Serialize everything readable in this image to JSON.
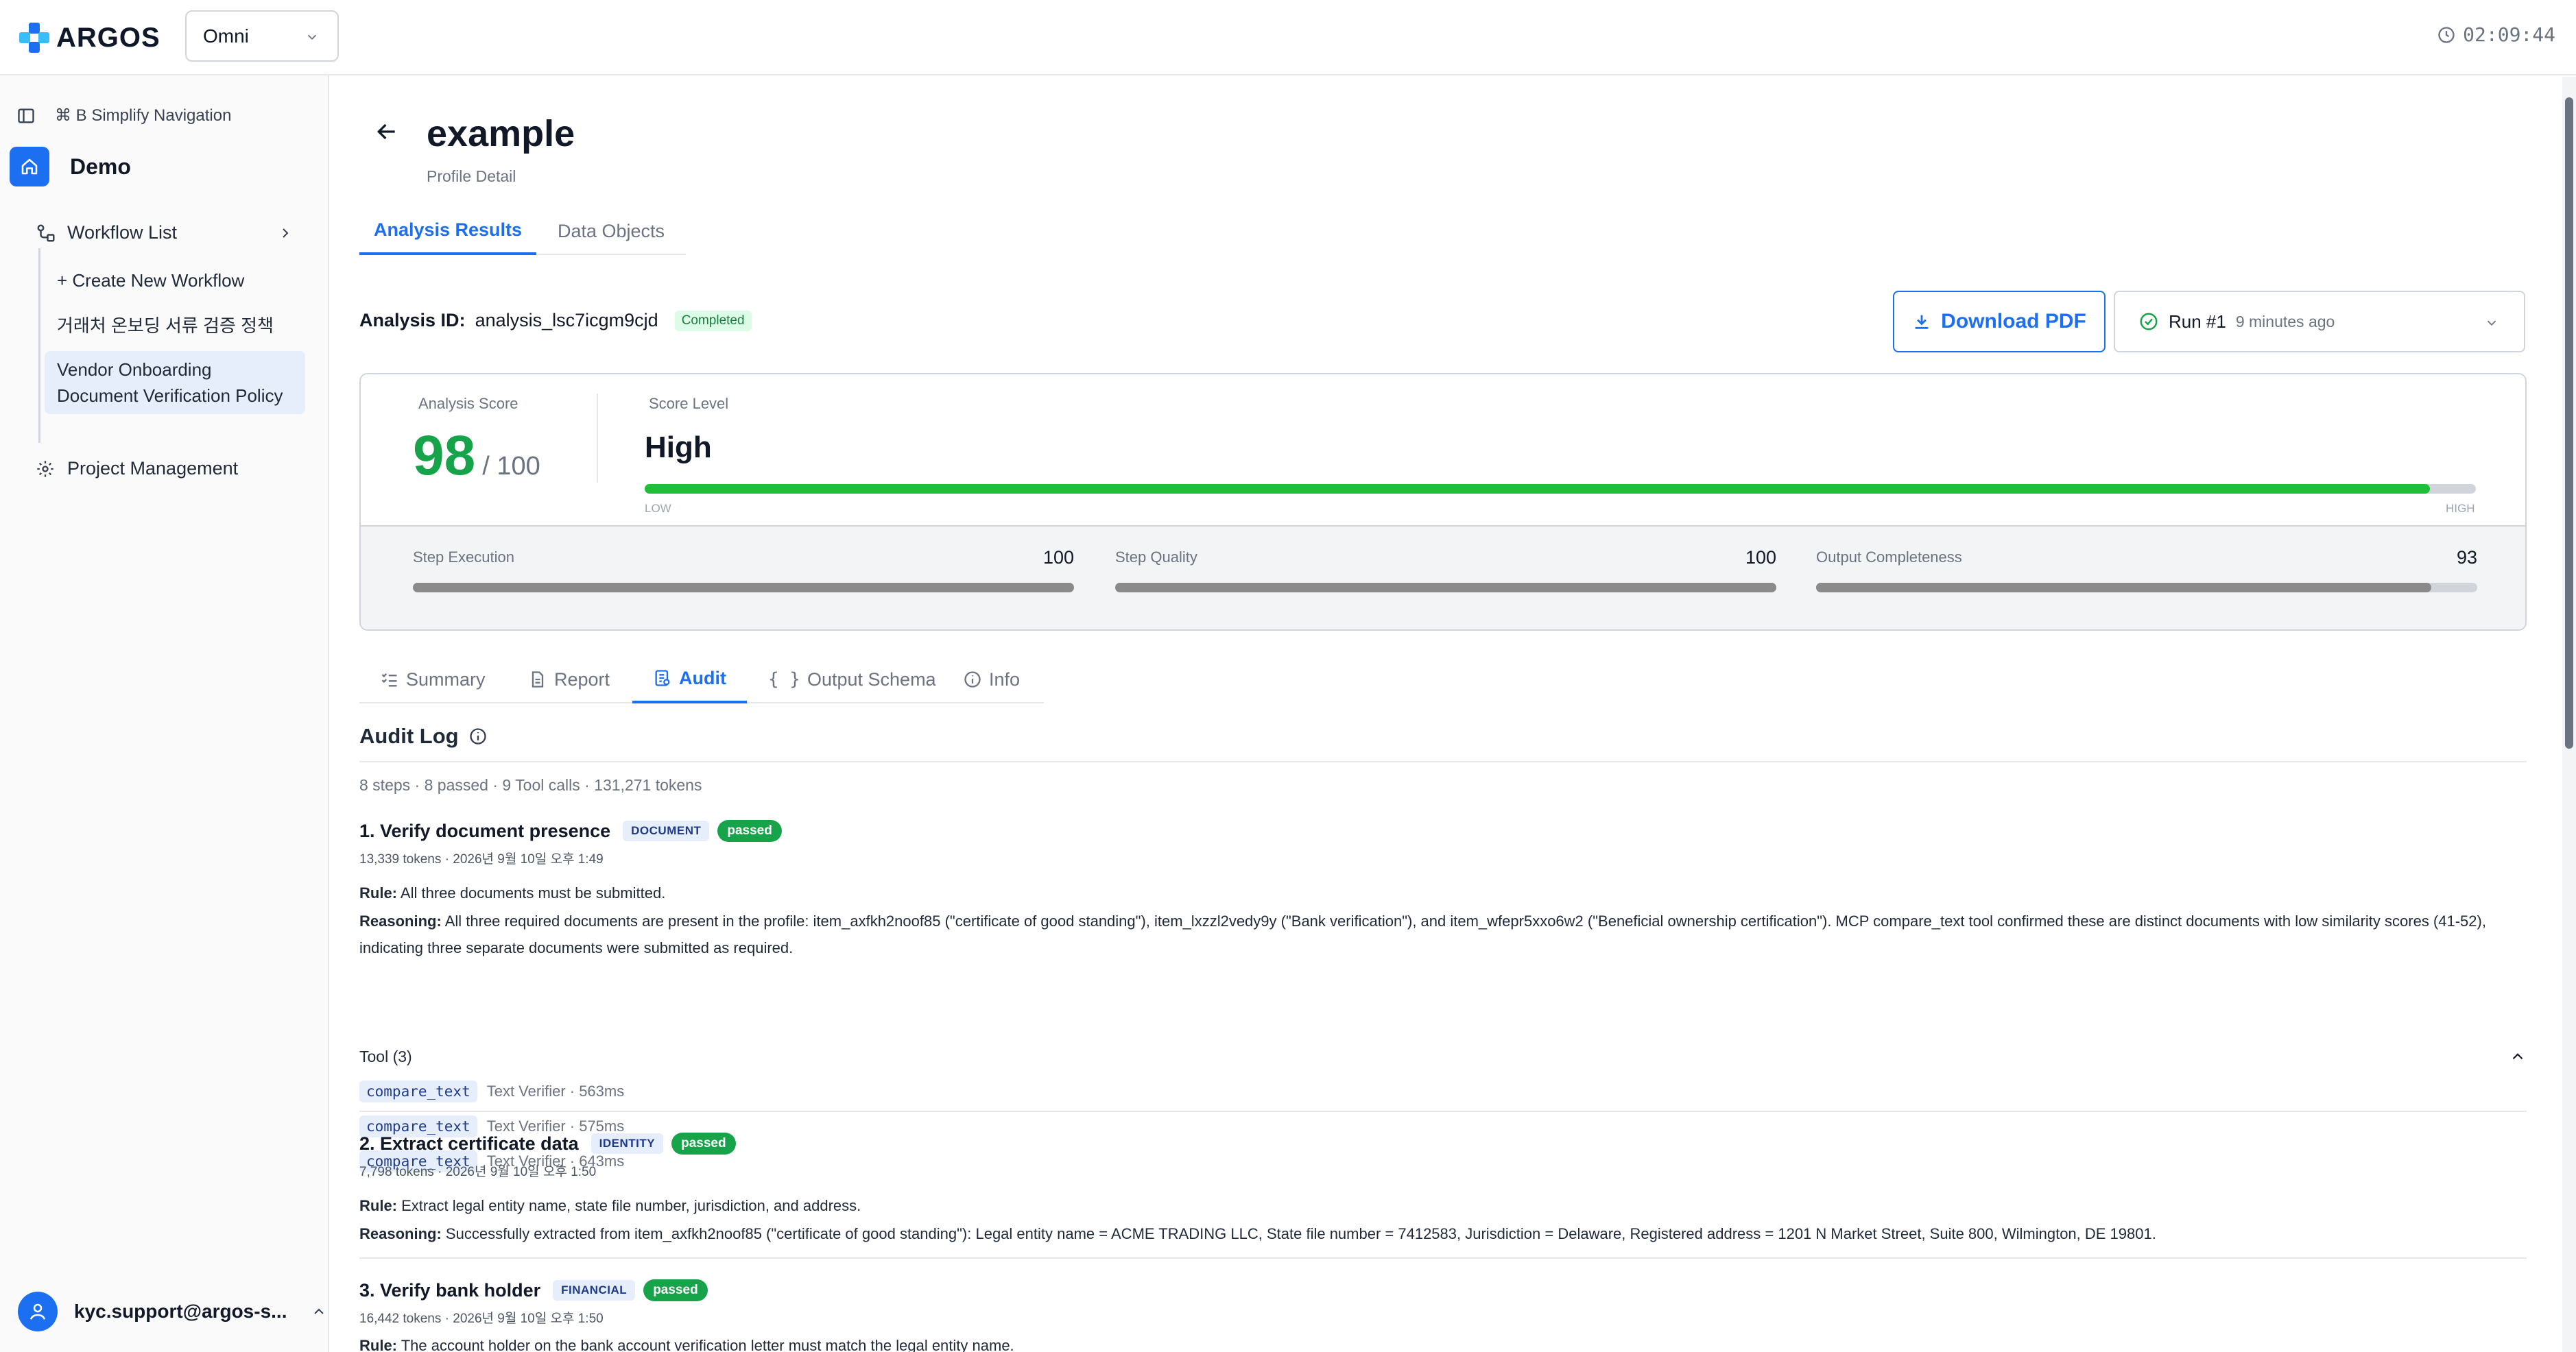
{
  "app": {
    "brand": "ARGOS",
    "workspace": "Omni",
    "timer": "02:09:44"
  },
  "sidebar": {
    "shortcut": "⌘ B Simplify Navigation",
    "project": "Demo",
    "workflow_list": "Workflow List",
    "items": [
      {
        "label": "+ Create New Workflow"
      },
      {
        "label": "거래처 온보딩 서류 검증 정책"
      },
      {
        "label": "Vendor Onboarding Document Verification Policy"
      }
    ],
    "project_management": "Project Management",
    "user": "kyc.support@argos-s..."
  },
  "page": {
    "title": "example",
    "subtitle": "Profile Detail",
    "tabs": [
      {
        "label": "Analysis Results"
      },
      {
        "label": "Data Objects"
      }
    ]
  },
  "analysis": {
    "id_label": "Analysis ID:",
    "id_value": "analysis_lsc7icgm9cjd",
    "status": "Completed",
    "download_label": "Download PDF",
    "run_label": "Run #1",
    "run_ago": "9 minutes ago"
  },
  "score": {
    "label": "Analysis Score",
    "value": "98",
    "max": "/ 100",
    "level_label": "Score Level",
    "level": "High",
    "level_fraction": 0.975,
    "low": "LOW",
    "high": "HIGH",
    "metrics": [
      {
        "label": "Step Execution",
        "value": "100",
        "fraction": 1.0
      },
      {
        "label": "Step Quality",
        "value": "100",
        "fraction": 1.0
      },
      {
        "label": "Output Completeness",
        "value": "93",
        "fraction": 0.93
      }
    ]
  },
  "subtabs": [
    {
      "label": "Summary",
      "icon": "list-check-icon"
    },
    {
      "label": "Report",
      "icon": "document-icon"
    },
    {
      "label": "Audit",
      "icon": "audit-icon"
    },
    {
      "label": "Output Schema",
      "icon": "braces-icon"
    },
    {
      "label": "Info",
      "icon": "info-icon"
    }
  ],
  "audit": {
    "title": "Audit Log",
    "stats": "8 steps · 8 passed · 9 Tool calls · 131,271 tokens",
    "steps": [
      {
        "name": "1. Verify document presence",
        "category": "DOCUMENT",
        "status": "passed",
        "meta": "13,339 tokens · 2026년 9월 10일 오후 1:49",
        "rule_label": "Rule:",
        "rule": "All three documents must be submitted.",
        "reasoning_label": "Reasoning:",
        "reasoning": "All three required documents are present in the profile: item_axfkh2noof85 (\"certificate of good standing\"), item_lxzzl2vedy9y (\"Bank verification\"), and item_wfepr5xxo6w2 (\"Beneficial ownership certification\"). MCP compare_text tool confirmed these are distinct documents with low similarity scores (41-52), indicating three separate documents were submitted as required.",
        "tools_label": "Tool (3)",
        "tools": [
          {
            "name": "compare_text",
            "detail": "Text Verifier · 563ms"
          },
          {
            "name": "compare_text",
            "detail": "Text Verifier · 575ms"
          },
          {
            "name": "compare_text",
            "detail": "Text Verifier · 643ms"
          }
        ]
      },
      {
        "name": "2. Extract certificate data",
        "category": "IDENTITY",
        "status": "passed",
        "meta": "7,798 tokens · 2026년 9월 10일 오후 1:50",
        "rule_label": "Rule:",
        "rule": "Extract legal entity name, state file number, jurisdiction, and address.",
        "reasoning_label": "Reasoning:",
        "reasoning": "Successfully extracted from item_axfkh2noof85 (\"certificate of good standing\"): Legal entity name = ACME TRADING LLC, State file number = 7412583, Jurisdiction = Delaware, Registered address = 1201 N Market Street, Suite 800, Wilmington, DE 19801."
      },
      {
        "name": "3. Verify bank holder",
        "category": "FINANCIAL",
        "status": "passed",
        "meta": "16,442 tokens · 2026년 9월 10일 오후 1:50",
        "rule_label": "Rule:",
        "rule": "The account holder on the bank account verification letter must match the legal entity name."
      }
    ]
  }
}
